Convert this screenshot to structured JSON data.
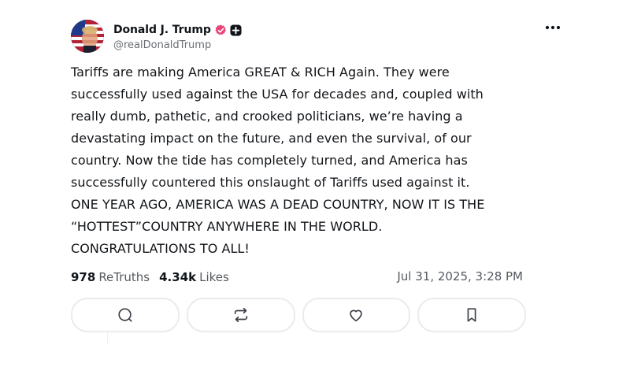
{
  "author": {
    "name": "Donald J. Trump",
    "handle": "@realDonaldTrump"
  },
  "post": {
    "text": "Tariffs are making America GREAT & RICH Again. They were\nsuccessfully used against the USA for decades and, coupled with\nreally dumb, pathetic, and crooked politicians, we’re having a\ndevastating impact on the future, and even the survival, of our\ncountry. Now the tide has completely turned, and America has\nsuccessfully countered this onslaught of Tariffs used against it.\nONE YEAR AGO, AMERICA WAS A DEAD COUNTRY, NOW IT IS THE\n“HOTTEST”COUNTRY ANYWHERE IN THE WORLD.\nCONGRATULATIONS TO ALL!"
  },
  "stats": {
    "retruths_count": "978",
    "retruths_label": "ReTruths",
    "likes_count": "4.34k",
    "likes_label": "Likes",
    "timestamp": "Jul 31, 2025, 3:28 PM"
  },
  "icons": {
    "more": "more-dots-icon",
    "reply": "reply-bubble-icon",
    "retruth": "retruth-arrows-icon",
    "like": "heart-icon",
    "bookmark": "bookmark-icon",
    "verified": "verified-badge-icon",
    "plus": "plus-badge-icon"
  },
  "colors": {
    "verified": "#e8467a",
    "text": "#0f1419",
    "muted": "#555a61",
    "border": "#e9ebee"
  }
}
